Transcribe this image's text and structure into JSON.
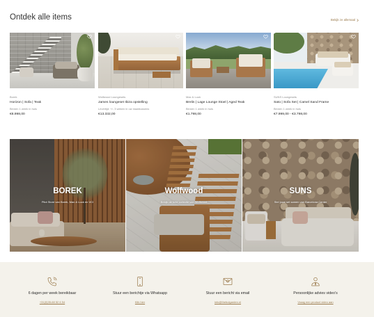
{
  "theme": {
    "accent": "#9b7b4d",
    "text": "#2d2d2d",
    "muted": "#8a8a8a",
    "footer_bg": "#f4f2eb"
  },
  "section": {
    "title": "Ontdek alle items",
    "view_all": "Bekijk ze allemaal",
    "view_all_icon": "chevron-right-icon"
  },
  "products": [
    {
      "brand": "Borek",
      "name": "Horizon | Sofa | Teak",
      "delivery": "Binnen 1 week in huis",
      "price": "€8.998,00",
      "favorite_icon": "heart-icon"
    },
    {
      "brand": "Wolfwood Loungesets",
      "name": "James loungeset Ibiza opstelling",
      "delivery": "Levertijd: +/- 3 weken in uw maatkussens",
      "price": "€13.332,00",
      "favorite_icon": "heart-icon"
    },
    {
      "brand": "Max & Luuk",
      "name": "Brelin | Lage Lounge Stoel | Aged Teak",
      "delivery": "Binnen 1 week in huis",
      "price": "€1.798,00",
      "favorite_icon": "heart-icon"
    },
    {
      "brand": "SUNS Loungesets",
      "name": "Sato | Sofa Set | Camel Sand Frame",
      "delivery": "Binnen 1 week in huis",
      "price": "€7.999,00 - €3.798,00",
      "favorite_icon": "heart-icon"
    }
  ],
  "banners": [
    {
      "title": "BOREK",
      "subtitle": "Pilot Store van Borek, Max & Luuk en VCI"
    },
    {
      "title": "Wolfwood",
      "subtitle": "Bekijk de hele collectie van Wolfwood"
    },
    {
      "title": "SUNS",
      "subtitle": "Stel jouw set samen van Barcelona Center"
    }
  ],
  "service": [
    {
      "icon": "phone-icon",
      "title": "6 dagen per week bereikbaar",
      "link": "+31(0)35-68 52 6 54"
    },
    {
      "icon": "mobile-icon",
      "title": "Stuur een berichtje via Whatsapp",
      "link": "Klik hier"
    },
    {
      "icon": "email-icon",
      "title": "Stuur een bericht via email",
      "link": "info@thebulgarden.nl"
    },
    {
      "icon": "video-advice-icon",
      "title": "Persoonlijke advies video's",
      "link": "Vraag een product video aan"
    }
  ]
}
